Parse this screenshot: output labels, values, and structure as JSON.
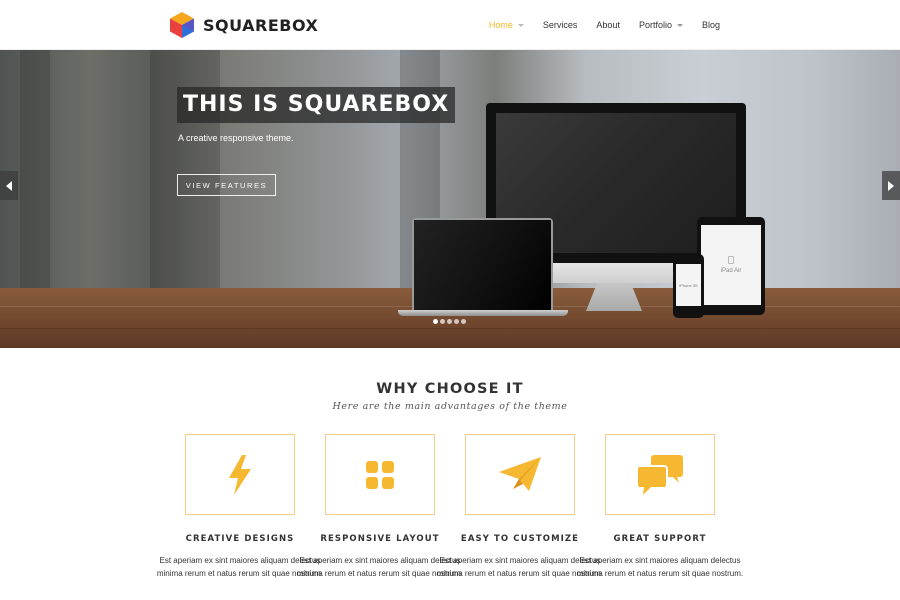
{
  "brand": {
    "name": "SQUAREBOX"
  },
  "nav": {
    "items": [
      {
        "label": "Home",
        "has_dropdown": true,
        "active": true
      },
      {
        "label": "Services",
        "has_dropdown": false,
        "active": false
      },
      {
        "label": "About",
        "has_dropdown": false,
        "active": false
      },
      {
        "label": "Portfolio",
        "has_dropdown": true,
        "active": false
      },
      {
        "label": "Blog",
        "has_dropdown": false,
        "active": false
      }
    ]
  },
  "hero": {
    "title": "THIS IS SQUAREBOX",
    "subtitle": "A creative responsive theme.",
    "button_label": "VIEW FEATURES",
    "slides": 5,
    "active_slide": 1,
    "ipad_label": "iPad Air",
    "iphone_label": "iPhone 5S"
  },
  "features": {
    "title": "WHY CHOOSE IT",
    "subtitle": "Here are the main advantages of the theme",
    "items": [
      {
        "icon": "lightning-icon",
        "title": "CREATIVE DESIGNS",
        "text": "Est aperiam ex sint maiores aliquam delectus minima rerum et natus rerum sit quae nostrum."
      },
      {
        "icon": "grid-icon",
        "title": "RESPONSIVE LAYOUT",
        "text": "Est aperiam ex sint maiores aliquam delectus minima rerum et natus rerum sit quae nostrum."
      },
      {
        "icon": "paper-plane-icon",
        "title": "EASY TO CUSTOMIZE",
        "text": "Est aperiam ex sint maiores aliquam delectus minima rerum et natus rerum sit quae nostrum."
      },
      {
        "icon": "chat-bubbles-icon",
        "title": "GREAT SUPPORT",
        "text": "Est aperiam ex sint maiores aliquam delectus minima rerum et natus rerum sit quae nostrum."
      }
    ]
  },
  "colors": {
    "accent": "#f6b831",
    "box_border": "#f6cf86",
    "text": "#333333"
  }
}
